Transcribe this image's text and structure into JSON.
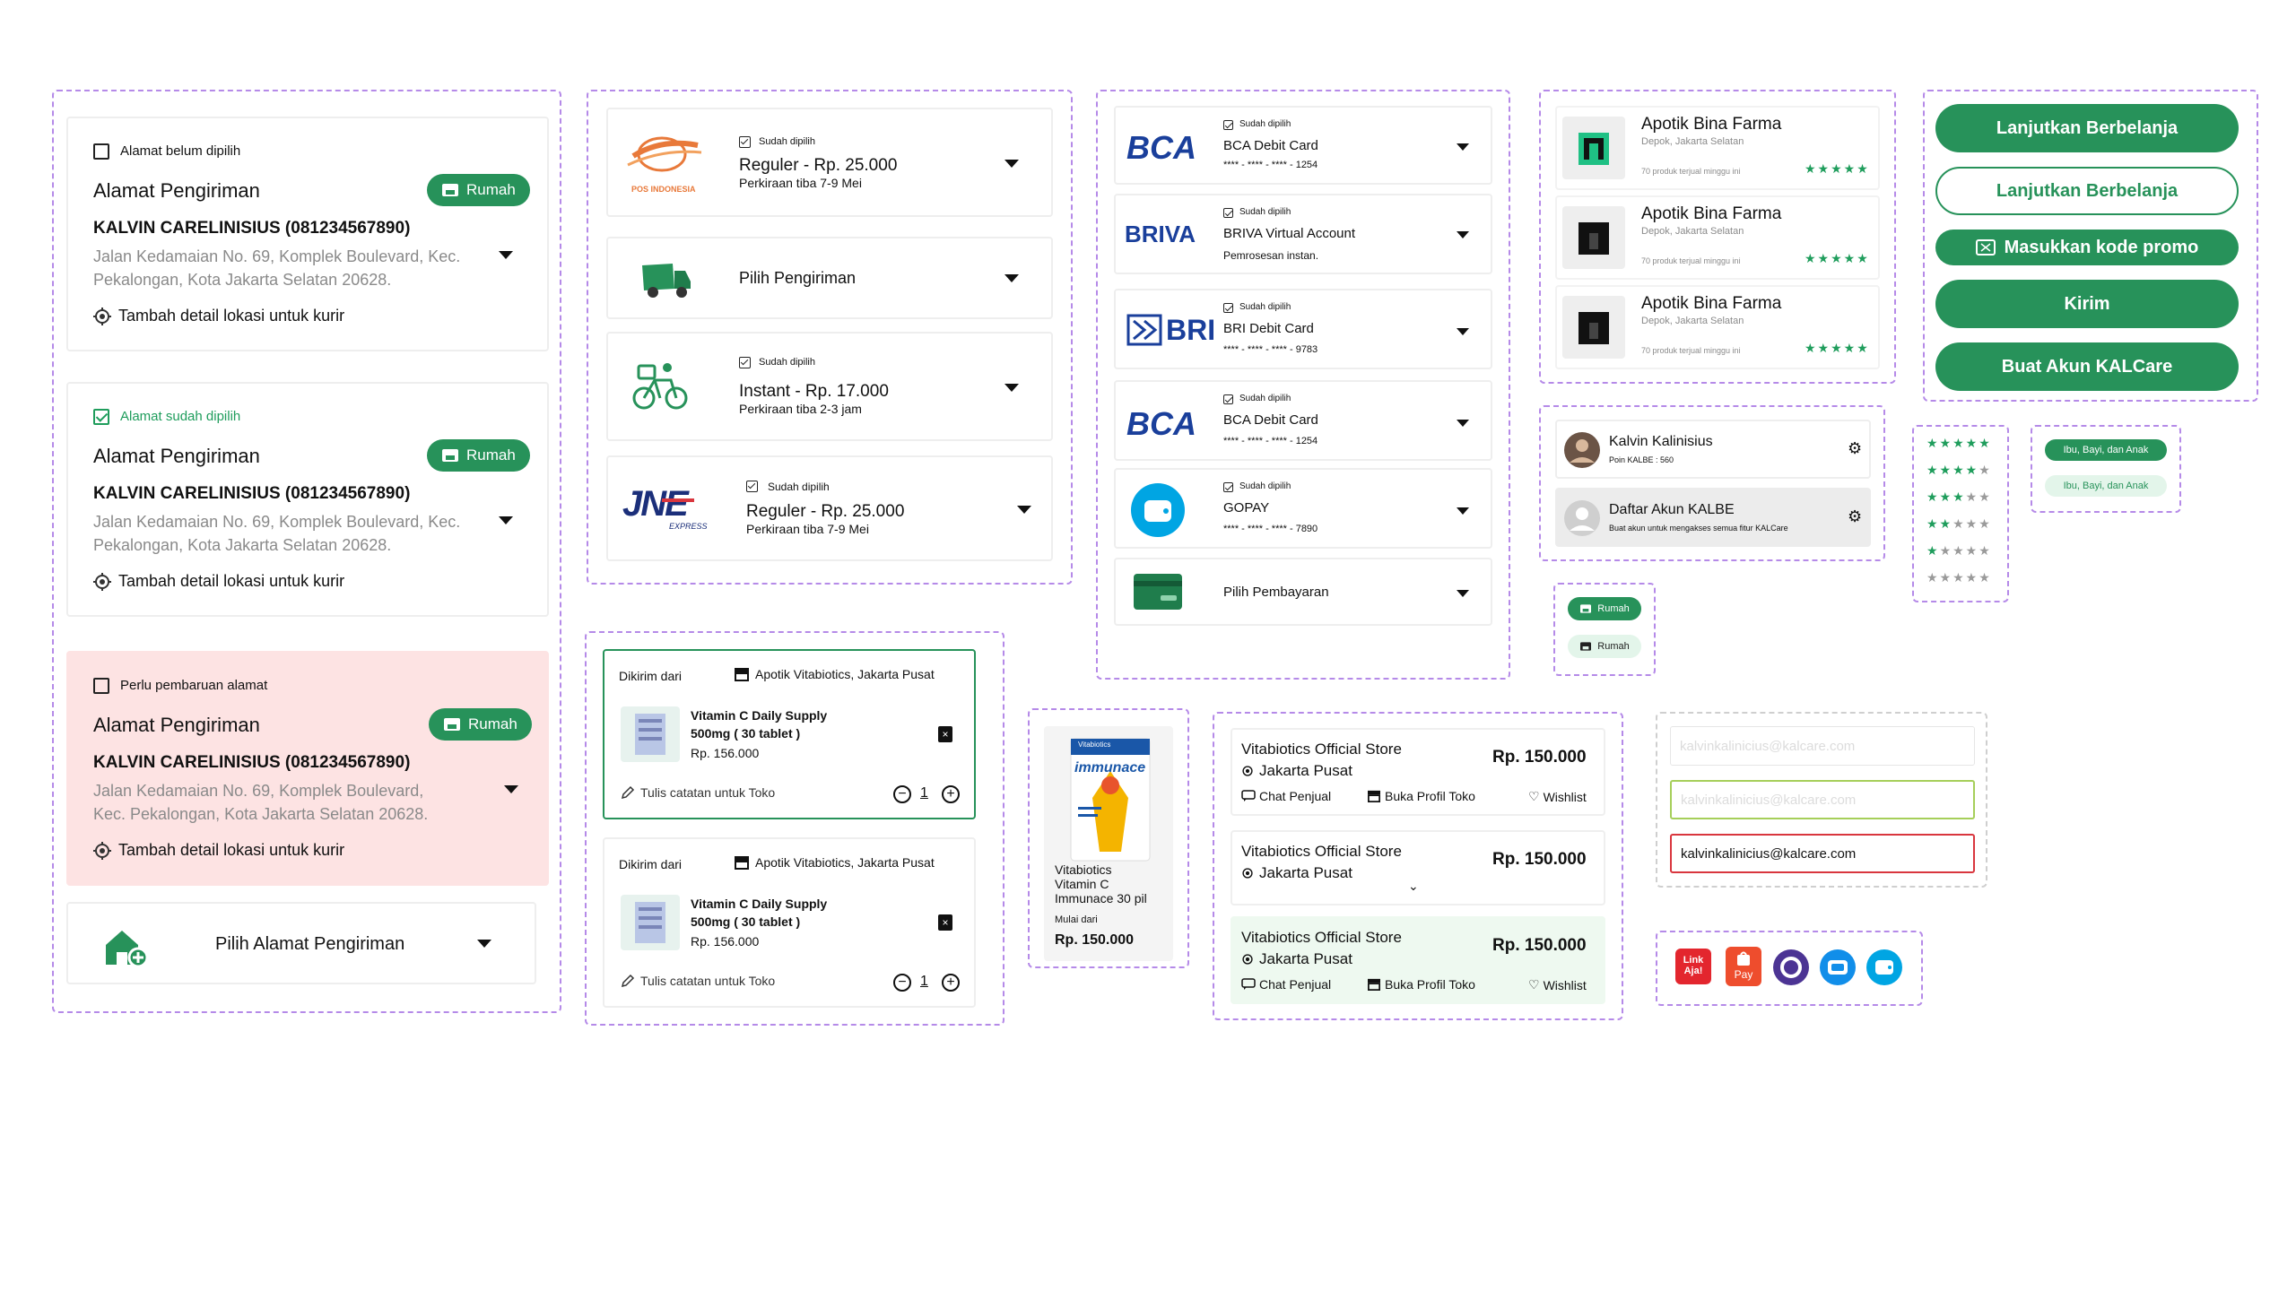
{
  "address": {
    "cards": [
      {
        "status": "Alamat belum dipilih",
        "title": "Alamat Pengiriman",
        "badge": "Rumah",
        "name": "KALVIN CARELINISIUS (081234567890)",
        "address": "Jalan Kedamaian No. 69, Komplek Boulevard, Kec.",
        "address2": "Pekalongan, Kota Jakarta Selatan 20628.",
        "detail": "Tambah detail lokasi untuk kurir"
      },
      {
        "status": "Alamat sudah dipilih",
        "title": "Alamat Pengiriman",
        "badge": "Rumah",
        "name": "KALVIN CARELINISIUS (081234567890)",
        "address": "Jalan Kedamaian No. 69, Komplek Boulevard, Kec.",
        "address2": "Pekalongan, Kota Jakarta Selatan 20628.",
        "detail": "Tambah detail lokasi untuk kurir"
      },
      {
        "status": "Perlu pembaruan alamat",
        "title": "Alamat Pengiriman",
        "badge": "Rumah",
        "name": "KALVIN CARELINISIUS (081234567890)",
        "address": "Jalan Kedamaian No. 69, Komplek Boulevard,",
        "address2": "Kec. Pekalongan, Kota Jakarta Selatan 20628.",
        "detail": "Tambah detail lokasi untuk kurir"
      }
    ],
    "choose": "Pilih Alamat Pengiriman"
  },
  "shipping": {
    "pos_logo": "POS INDONESIA",
    "jne_logo": "JNE",
    "jne_sub": "EXPRESS",
    "items": [
      {
        "chosen": "Sudah dipilih",
        "service": "Reguler  -  Rp. 25.000",
        "eta": "Perkiraan tiba 7-9 Mei"
      },
      {
        "label": "Pilih Pengiriman"
      },
      {
        "chosen": "Sudah dipilih",
        "service": "Instant  -  Rp. 17.000",
        "eta": "Perkiraan tiba 2-3 jam"
      },
      {
        "chosen": "Sudah dipilih",
        "service": "Reguler  -  Rp. 25.000",
        "eta": "Perkiraan tiba 7-9 Mei"
      }
    ]
  },
  "payment": {
    "items": [
      {
        "logo": "BCA",
        "chosen": "Sudah dipilih",
        "name": "BCA Debit Card",
        "sub": "**** - **** - **** - 1254"
      },
      {
        "logo": "BRIVA",
        "chosen": "Sudah dipilih",
        "name": "BRIVA Virtual Account",
        "sub": "Pemrosesan instan."
      },
      {
        "logo": "BRI",
        "chosen": "Sudah dipilih",
        "name": "BRI Debit Card",
        "sub": "**** - **** - **** - 9783"
      },
      {
        "logo": "BCA",
        "chosen": "Sudah dipilih",
        "name": "BCA Debit Card",
        "sub": "**** - **** - **** - 1254"
      },
      {
        "chosen": "Sudah dipilih",
        "name": "GOPAY",
        "sub": "**** - **** - **** - 7890"
      },
      {
        "name": "Pilih Pembayaran"
      }
    ]
  },
  "pharmacies": [
    {
      "name": "Apotik Bina Farma",
      "location": "Depok, Jakarta Selatan",
      "sold": "70 produk terjual minggu ini",
      "stars": "★★★★★"
    },
    {
      "name": "Apotik Bina Farma",
      "location": "Depok, Jakarta Selatan",
      "sold": "70 produk terjual minggu ini",
      "stars": "★★★★★"
    },
    {
      "name": "Apotik Bina Farma",
      "location": "Depok, Jakarta Selatan",
      "sold": "70 produk terjual minggu ini",
      "stars": "★★★★★"
    }
  ],
  "buttons": {
    "continue1": "Lanjutkan Berbelanja",
    "continue2": "Lanjutkan Berbelanja",
    "promo": "Masukkan kode promo",
    "send": "Kirim",
    "create": "Buat Akun KALCare"
  },
  "account": {
    "user_name": "Kalvin Kalinisius",
    "user_points": "Poin KALBE : 560",
    "register_title": "Daftar Akun KALBE",
    "register_sub": "Buat akun untuk mengakses semua fitur KALCare"
  },
  "ratings": [
    "★★★★★",
    "★★★★",
    "★★★",
    "★★",
    "★",
    ""
  ],
  "ratings_empty": [
    "",
    "★",
    "★★",
    "★★★",
    "★★★★",
    "★★★★★"
  ],
  "tags": {
    "tag1": "Ibu, Bayi, dan Anak",
    "tag2": "Ibu, Bayi, dan Anak"
  },
  "rumah_tags": {
    "tag1": "Rumah",
    "tag2": "Rumah"
  },
  "cart": [
    {
      "sent_from": "Dikirim dari",
      "store": "Apotik Vitabiotics, Jakarta Pusat",
      "product": "Vitamin C Daily Supply",
      "variant": "500mg ( 30 tablet )",
      "price": "Rp. 156.000",
      "note": "Tulis catatan untuk Toko",
      "qty": "1"
    },
    {
      "sent_from": "Dikirim dari",
      "store": "Apotik Vitabiotics, Jakarta Pusat",
      "product": "Vitamin C Daily Supply",
      "variant": "500mg ( 30 tablet )",
      "price": "Rp. 156.000",
      "note": "Tulis catatan untuk Toko",
      "qty": "1"
    }
  ],
  "product_card": {
    "brand": "Vitabiotics",
    "line1": "Vitabiotics",
    "line2": "Vitamin C",
    "line3": "Immunace 30 pil",
    "from": "Mulai dari",
    "price": "Rp. 150.000",
    "package_text": "immunace"
  },
  "stores": [
    {
      "name": "Vitabiotics Official Store",
      "location": "Jakarta Pusat",
      "price": "Rp. 150.000",
      "chat": "Chat Penjual",
      "profile": "Buka Profil Toko",
      "wishlist": "Wishlist"
    },
    {
      "name": "Vitabiotics Official Store",
      "location": "Jakarta Pusat",
      "price": "Rp. 150.000"
    },
    {
      "name": "Vitabiotics Official Store",
      "location": "Jakarta Pusat",
      "price": "Rp. 150.000",
      "chat": "Chat Penjual",
      "profile": "Buka Profil Toko",
      "wishlist": "Wishlist"
    }
  ],
  "inputs": {
    "email1": "kalvinkalinicius@kalcare.com",
    "email2": "kalvinkalinicius@kalcare.com",
    "email3": "kalvinkalinicius@kalcare.com"
  },
  "apps": {
    "linkaja_line1": "Link",
    "linkaja_line2": "Aja!",
    "shopee_label": "Pay"
  },
  "colors": {
    "primary": "#27925a",
    "frame": "#b58ae8",
    "danger_bg": "#fde3e3",
    "error": "#d9363e",
    "success_border": "#a6cf5a"
  }
}
